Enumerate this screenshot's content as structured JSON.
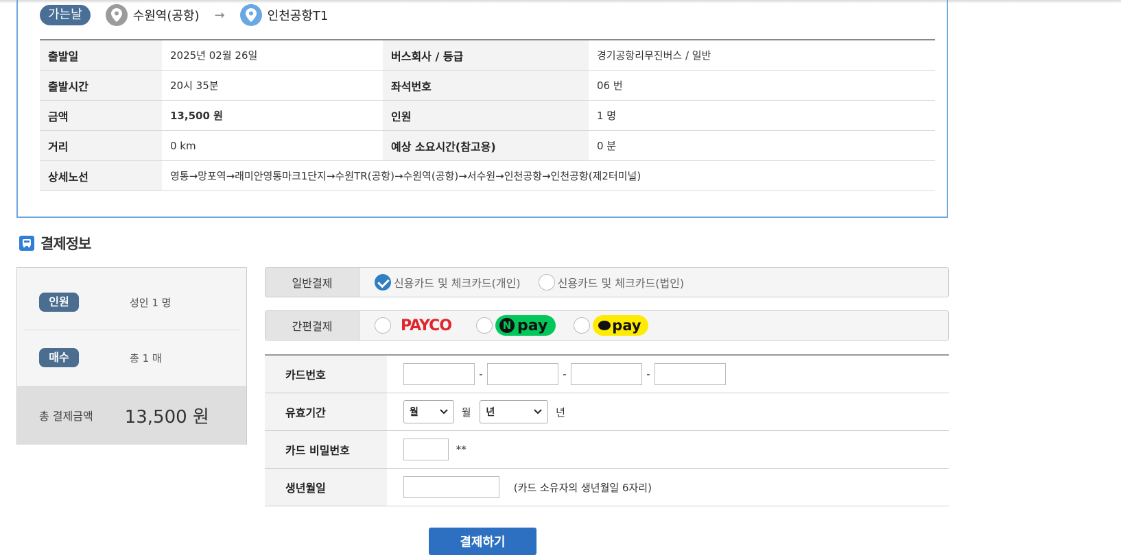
{
  "trip": {
    "direction_badge": "가는날",
    "origin": "수원역(공항)",
    "arrow": "→",
    "destination": "인천공항T1",
    "rows": [
      {
        "label1": "출발일",
        "value1": "2025년 02월 26일",
        "label2": "버스회사 / 등급",
        "value2": "경기공항리무진버스 / 일반"
      },
      {
        "label1": "출발시간",
        "value1": "20시 35분",
        "label2": "좌석번호",
        "value2": "06 번"
      },
      {
        "label1": "금액",
        "value1": "13,500 원",
        "label2": "인원",
        "value2": "1 명"
      },
      {
        "label1": "거리",
        "value1": "0 km",
        "label2": "예상 소요시간(참고용)",
        "value2": "0 분"
      }
    ],
    "route_label": "상세노선",
    "route_value": "영통→망포역→래미안영통마크1단지→수원TR(공항)→수원역(공항)→서수원→인천공항→인천공항(제2터미널)"
  },
  "payment": {
    "section_title": "결제정보",
    "summary": {
      "people_label": "인원",
      "people_value": "성인 1 명",
      "tickets_label": "매수",
      "tickets_value": "총 1 매",
      "total_label": "총 결제금액",
      "total_value": "13,500 원"
    },
    "general": {
      "label": "일반결제",
      "option_personal": "신용카드 및 체크카드(개인)",
      "option_corporate": "신용카드 및 체크카드(법인)",
      "selected": "personal"
    },
    "easy": {
      "label": "간편결제",
      "payco": "PAYCO",
      "npay_n": "N",
      "npay": "pay",
      "kakaopay": "pay"
    },
    "card": {
      "number_label": "카드번호",
      "dash": "-",
      "expiry_label": "유효기간",
      "month_select": "월",
      "month_unit": "월",
      "year_select": "년",
      "year_unit": "년",
      "password_label": "카드 비밀번호",
      "password_suffix": "**",
      "birth_label": "생년월일",
      "birth_hint": "(카드 소유자의 생년월일 6자리)"
    },
    "submit_label": "결제하기"
  },
  "colors": {
    "accent": "#2d6fc1",
    "badge": "#4a6f97",
    "payco": "#e0262d",
    "npay": "#03c75a",
    "kakaopay": "#ffeb00"
  }
}
